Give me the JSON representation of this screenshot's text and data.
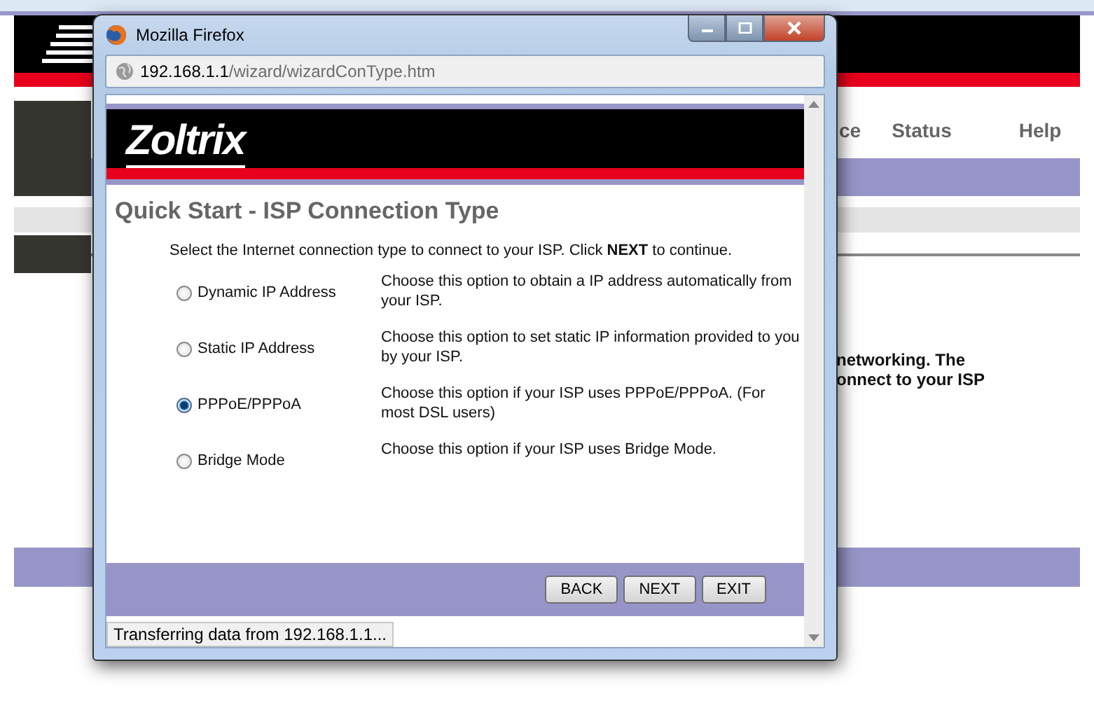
{
  "background_page": {
    "nav_items": [
      {
        "label": "ce"
      },
      {
        "label": "Status"
      },
      {
        "label": "Help"
      }
    ],
    "body_lines": [
      "networking. The",
      "onnect to your ISP"
    ]
  },
  "window": {
    "title": "Mozilla Firefox",
    "address": {
      "host": "192.168.1.1",
      "path": "/wizard/wizardConType.htm"
    }
  },
  "page": {
    "logo": "Zoltrix",
    "heading": "Quick Start - ISP Connection Type",
    "intro": "Select the Internet connection type to connect to your ISP. Click **NEXT** to continue.",
    "options": [
      {
        "label": "Dynamic IP Address",
        "description": "Choose this option to obtain a IP address automatically from your ISP.",
        "selected": false
      },
      {
        "label": "Static IP Address",
        "description": "Choose this option to set static IP information provided to you by your ISP.",
        "selected": false
      },
      {
        "label": "PPPoE/PPPoA",
        "description": "Choose this option if your ISP uses PPPoE/PPPoA. (For most DSL users)",
        "selected": true
      },
      {
        "label": "Bridge Mode",
        "description": "Choose this option if your ISP uses Bridge Mode.",
        "selected": false
      }
    ],
    "buttons": [
      {
        "label": "BACK"
      },
      {
        "label": "NEXT"
      },
      {
        "label": "EXIT"
      }
    ]
  },
  "status_bar": "Transferring data from 192.168.1.1..."
}
